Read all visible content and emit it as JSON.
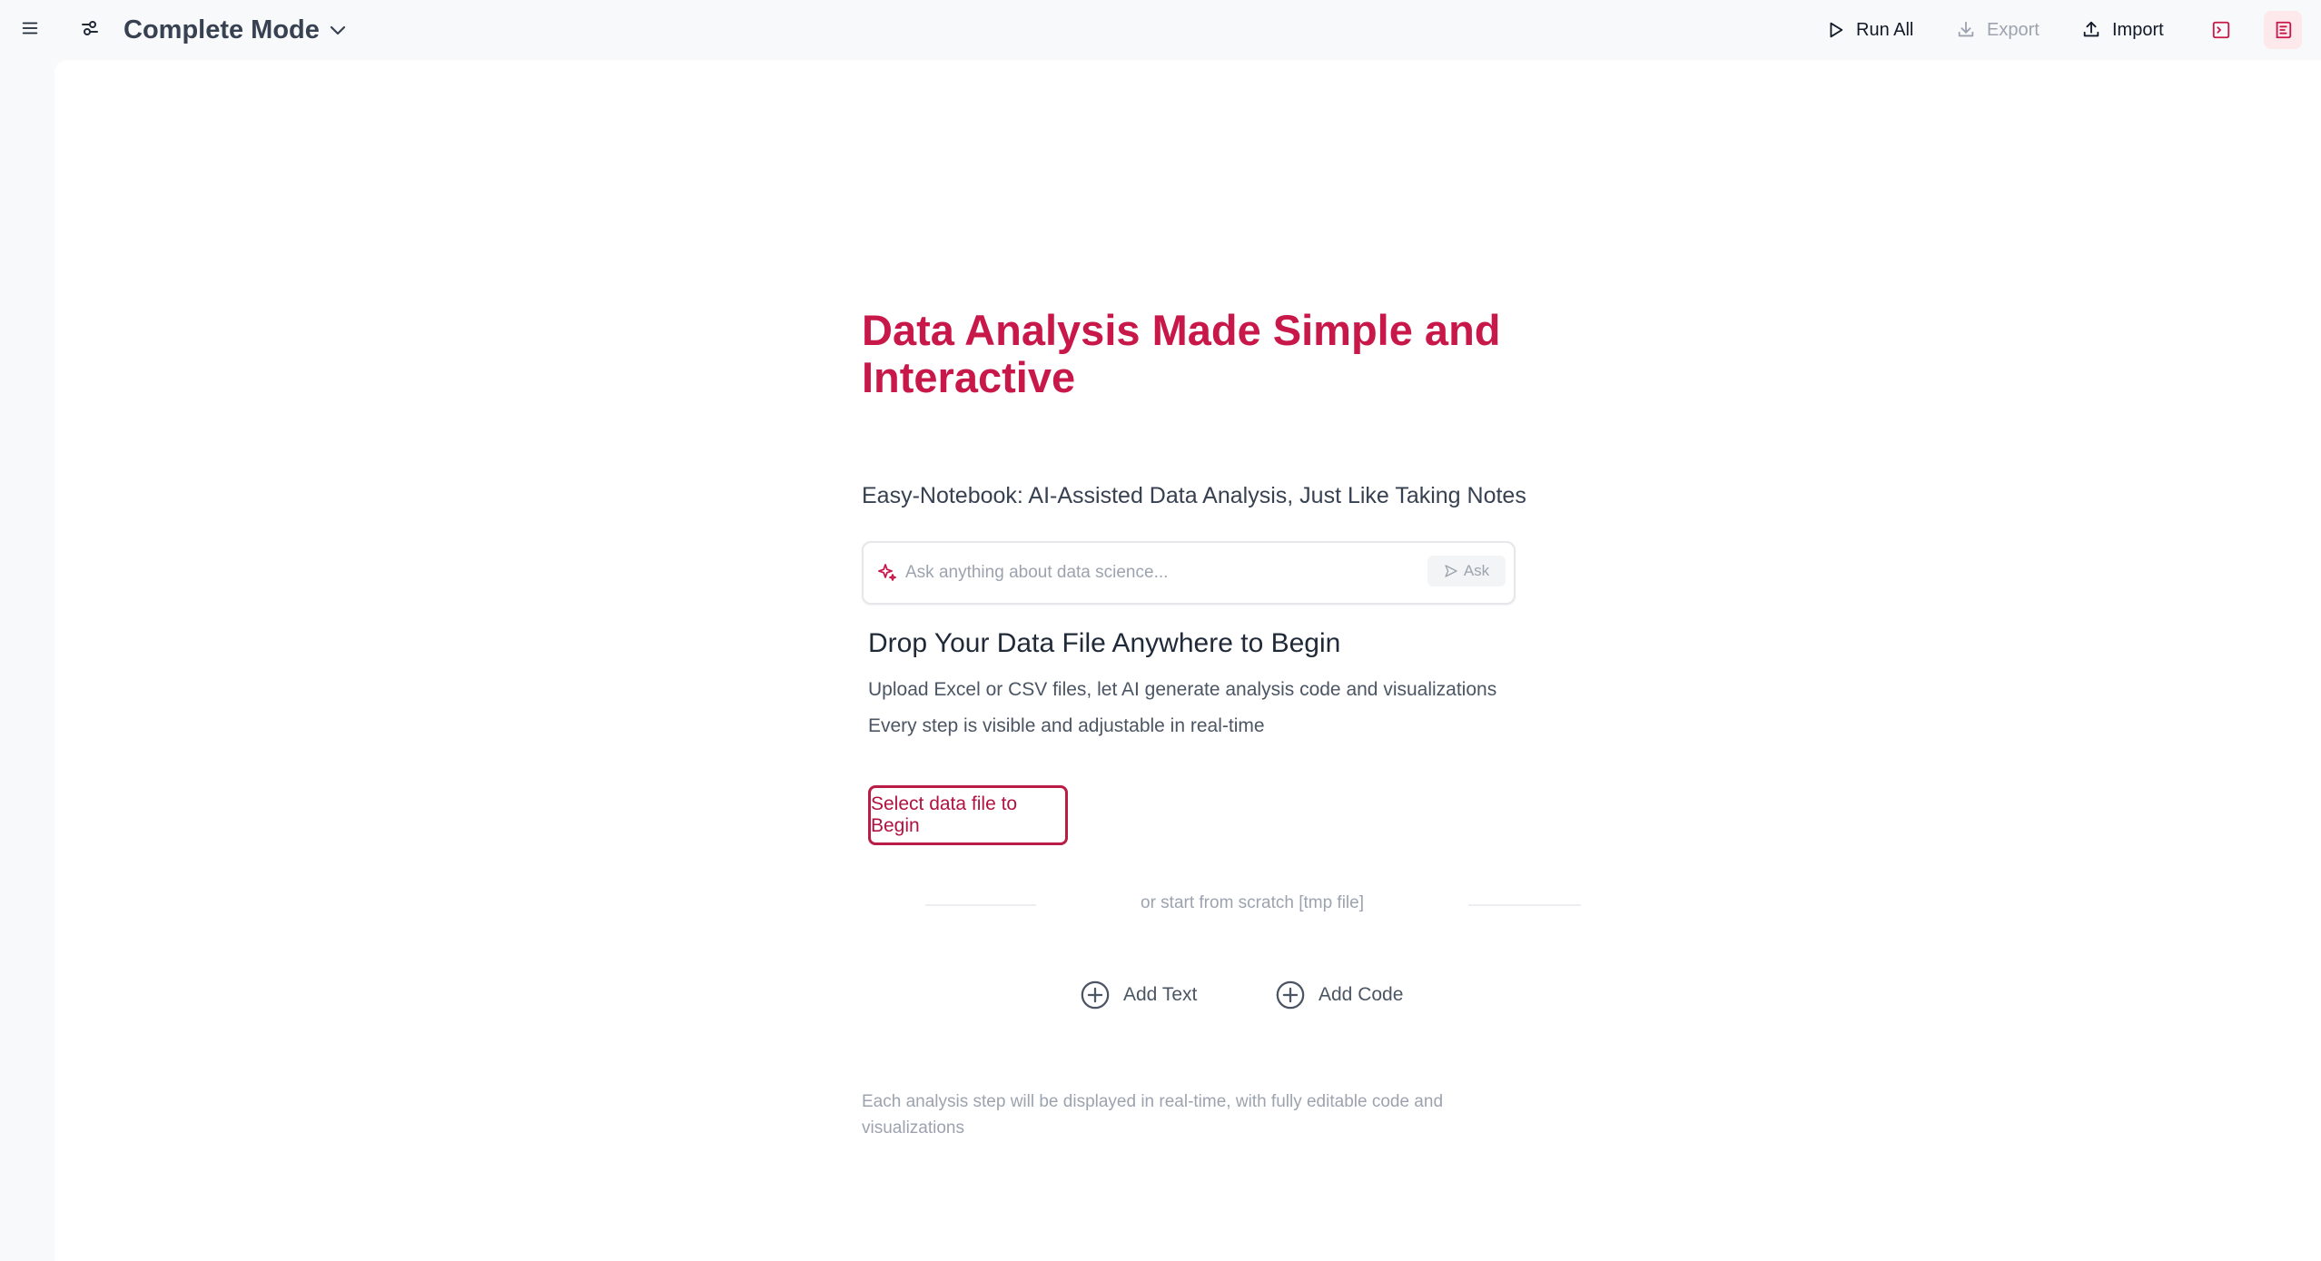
{
  "header": {
    "mode_label": "Complete Mode",
    "run_all_label": "Run All",
    "export_label": "Export",
    "import_label": "Import"
  },
  "hero": {
    "title": "Data Analysis Made Simple and Interactive",
    "subtitle": "Easy-Notebook: AI-Assisted Data Analysis, Just Like Taking Notes"
  },
  "ask": {
    "placeholder": "Ask anything about data science...",
    "button_label": "Ask"
  },
  "upload": {
    "title": "Drop Your Data File Anywhere to Begin",
    "desc_line1": "Upload Excel or CSV files, let AI generate analysis code and visualizations",
    "desc_line2": "Every step is visible and adjustable in real-time",
    "select_button_label": "Select data file to Begin"
  },
  "scratch": {
    "divider_text": "or start from scratch [tmp file]",
    "add_text_label": "Add Text",
    "add_code_label": "Add Code"
  },
  "footnote": "Each analysis step will be displayed in real-time, with fully editable code and visualizations",
  "colors": {
    "accent": "#c8184a",
    "accent_button": "#b91c45",
    "active_icon_bg": "#fde8ec",
    "muted_text": "#9ca3af"
  },
  "icons": {
    "menu": "menu-icon",
    "settings": "sliders-icon",
    "mode_dropdown": "chevron-down-icon",
    "run_all": "play-icon",
    "export": "download-icon",
    "import": "upload-icon",
    "terminal": "terminal-icon",
    "panel": "panel-icon",
    "ask_sparkle": "sparkle-icon",
    "ask_send": "send-icon",
    "add": "plus-circle-icon"
  }
}
